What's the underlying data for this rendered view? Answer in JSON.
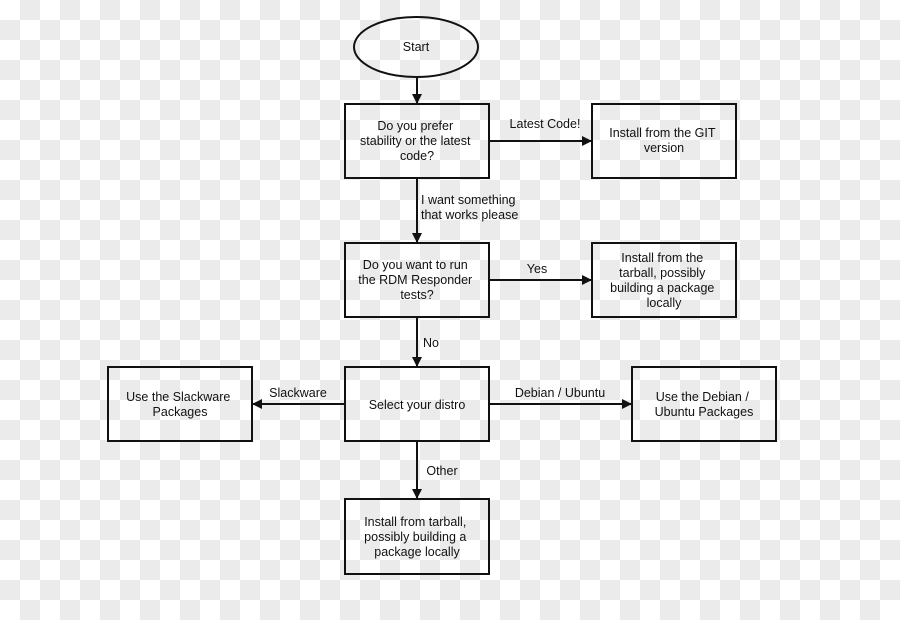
{
  "nodes": {
    "start": [
      "Start"
    ],
    "q_stability": [
      "Do you prefer",
      "stability or the latest",
      "code?"
    ],
    "git": [
      "Install from the GIT",
      "version"
    ],
    "q_rdm": [
      "Do you want to run",
      "the RDM Responder",
      "tests?"
    ],
    "tarball_yes": [
      "Install from the",
      "tarball, possibly",
      "building a package",
      "locally"
    ],
    "distro": [
      "Select your distro"
    ],
    "slackware": [
      "Use the Slackware",
      "Packages"
    ],
    "debian": [
      "Use the Debian /",
      "Ubuntu Packages"
    ],
    "tarball_other": [
      "Install from tarball,",
      "possibly building a",
      "package locally"
    ]
  },
  "edges": {
    "latest": [
      "Latest Code!"
    ],
    "stable": [
      "I want something",
      "that works please"
    ],
    "yes": [
      "Yes"
    ],
    "no": [
      "No"
    ],
    "slackware": [
      "Slackware"
    ],
    "debian": [
      "Debian / Ubuntu"
    ],
    "other": [
      "Other"
    ]
  }
}
